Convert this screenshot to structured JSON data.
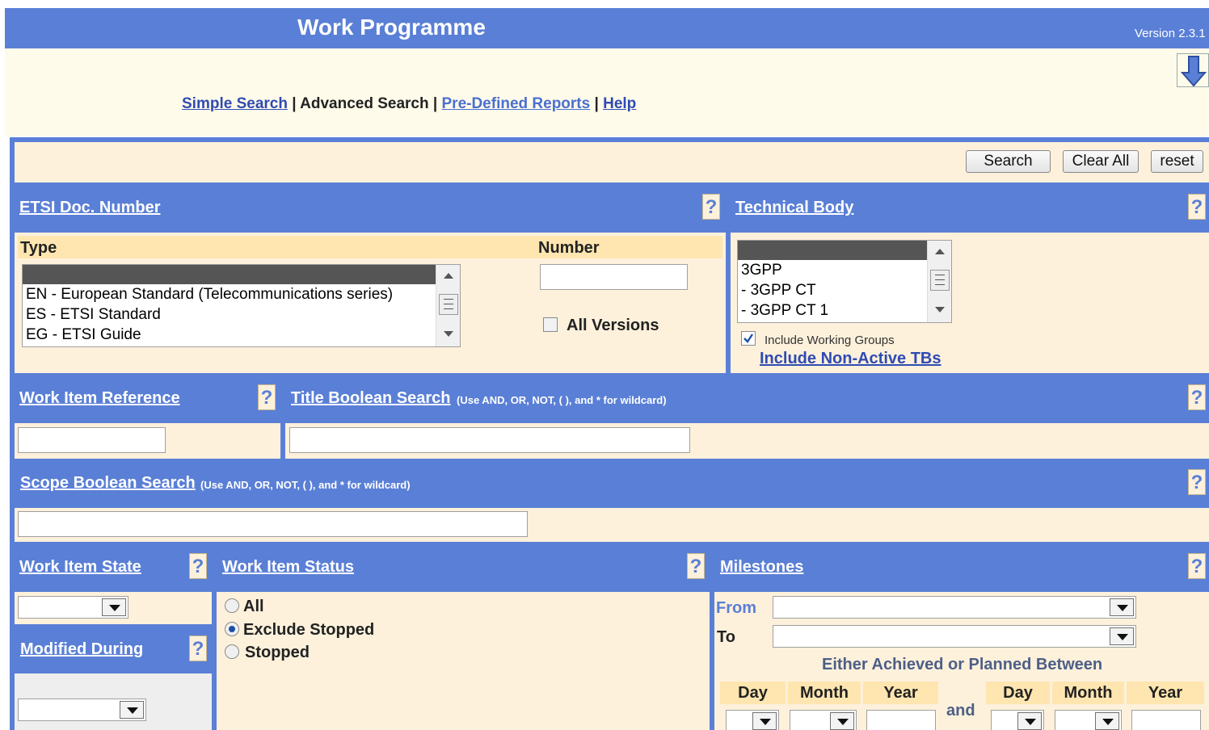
{
  "header": {
    "title": "Work Programme",
    "version": "Version 2.3.1"
  },
  "download_icon": "download-arrow-icon",
  "nav": {
    "simple": "Simple Search",
    "advanced": "Advanced Search",
    "predefined": "Pre-Defined Reports",
    "help": "Help",
    "separator": "|"
  },
  "toolbar": {
    "search": "Search",
    "clear_all": "Clear All",
    "reset": "reset"
  },
  "help_glyph": "?",
  "etsi_doc": {
    "title": "ETSI Doc. Number",
    "type_label": "Type",
    "number_label": "Number",
    "types": [
      "",
      "EN - European Standard (Telecommunications series)",
      "ES - ETSI Standard",
      "EG - ETSI Guide"
    ],
    "all_versions": "All Versions",
    "number_value": ""
  },
  "technical_body": {
    "title": "Technical Body",
    "options": [
      "",
      "3GPP",
      "- 3GPP CT",
      "- 3GPP CT 1"
    ],
    "include_wg": "Include Working Groups",
    "include_wg_checked": true,
    "include_nonactive": "Include Non-Active TBs"
  },
  "work_item_reference": {
    "title": "Work Item Reference",
    "value": ""
  },
  "title_boolean": {
    "title": "Title Boolean Search",
    "note": "(Use AND, OR, NOT, ( ), and * for wildcard)",
    "value": ""
  },
  "scope_boolean": {
    "title": "Scope Boolean Search",
    "note": "(Use AND, OR, NOT, ( ), and * for wildcard)",
    "value": ""
  },
  "work_item_state": {
    "title": "Work Item State",
    "selected": ""
  },
  "modified_during": {
    "title": "Modified During",
    "selected": ""
  },
  "work_item_status": {
    "title": "Work Item Status",
    "options": [
      "All",
      "Exclude Stopped",
      "Stopped"
    ],
    "selected": "Exclude Stopped"
  },
  "milestones": {
    "title": "Milestones",
    "from": "From",
    "to": "To",
    "between": "Either Achieved or Planned Between",
    "and": "and",
    "cols": [
      "Day",
      "Month",
      "Year",
      "Day",
      "Month",
      "Year"
    ]
  }
}
